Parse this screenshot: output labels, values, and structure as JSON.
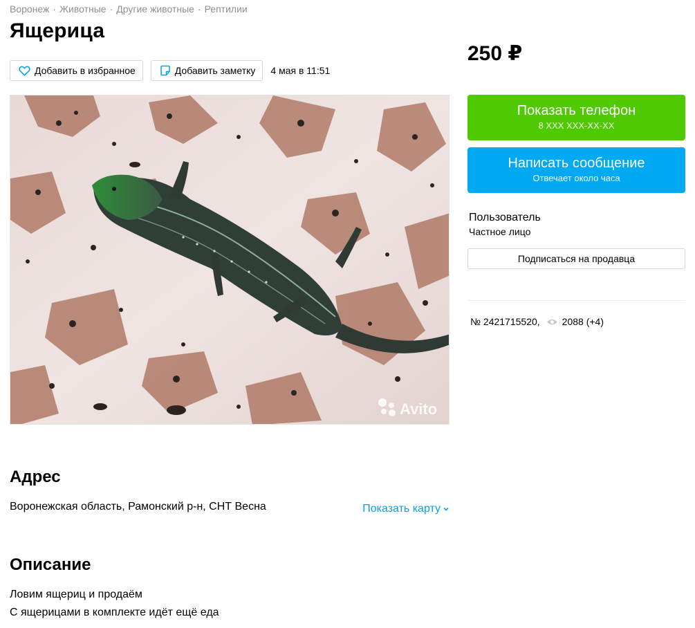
{
  "breadcrumbs": [
    "Воронеж",
    "Животные",
    "Другие животные",
    "Рептилии"
  ],
  "breadcrumb_separator": "·",
  "title": "Ящерица",
  "actions": {
    "favorite_label": "Добавить в избранное",
    "note_label": "Добавить заметку",
    "date": "4 мая в 11:51"
  },
  "photo": {
    "watermark": "Avito"
  },
  "price": "250 ₽",
  "phone_button": {
    "label": "Показать телефон",
    "sub": "8 XXX XXX-XX-XX",
    "color": "#4fca00"
  },
  "message_button": {
    "label": "Написать сообщение",
    "sub": "Отвечает около часа",
    "color": "#00a9f2"
  },
  "seller": {
    "role": "Пользователь",
    "type": "Частное лицо",
    "subscribe_label": "Подписаться на продавца"
  },
  "listing_meta": {
    "number": "№ 2421715520,",
    "views": "2088 (+4)"
  },
  "address": {
    "heading": "Адрес",
    "text": "Воронежская область, Рамонский р-н, СНТ Весна",
    "map_link": "Показать карту"
  },
  "description": {
    "heading": "Описание",
    "lines": [
      "Ловим ящериц и продаём",
      "С ящерицами в комплекте идёт ещё еда"
    ]
  },
  "icons": {
    "favorite": "heart-icon",
    "note": "note-icon",
    "views": "eye-icon",
    "map": "chevron-down-icon"
  }
}
